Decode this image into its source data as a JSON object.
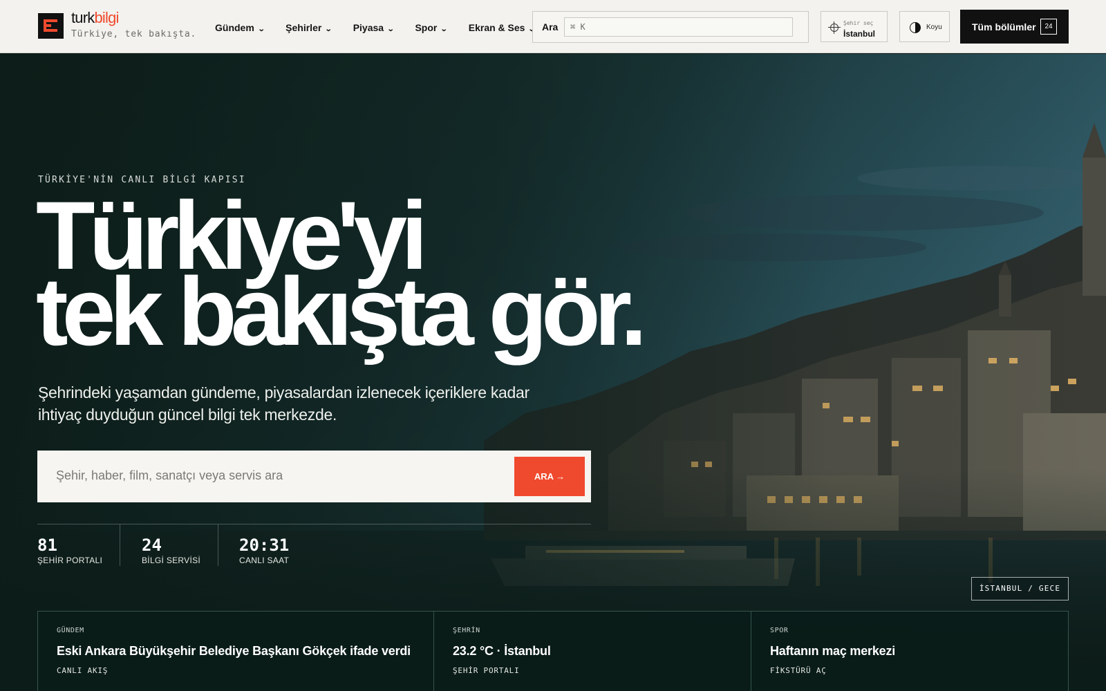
{
  "brand": {
    "name_part1": "turk",
    "name_part2": "bilgi",
    "tagline": "Türkiye, tek bakışta.",
    "accent_color": "#f04a2e"
  },
  "nav": {
    "items": [
      {
        "label": "Gündem"
      },
      {
        "label": "Şehirler"
      },
      {
        "label": "Piyasa"
      },
      {
        "label": "Spor"
      },
      {
        "label": "Ekran & Ses"
      }
    ],
    "chevron_icon": "chevron-down-icon"
  },
  "header_search": {
    "label": "Ara",
    "shortcut": "⌘ K"
  },
  "city_selector": {
    "caption": "Şehir seç",
    "value": "İstanbul",
    "icon": "crosshair-icon"
  },
  "theme_toggle": {
    "label": "Koyu",
    "icon": "half-moon-icon"
  },
  "all_sections": {
    "label": "Tüm bölümler",
    "count": "24"
  },
  "hero": {
    "eyebrow": "TÜRKİYE'NİN CANLI BİLGİ KAPISI",
    "headline_line1": "Türkiye'yi",
    "headline_line2": "tek bakışta gör.",
    "subtitle": "Şehrindeki yaşamdan gündeme, piyasalardan izlenecek içeriklere kadar ihtiyaç duyduğun güncel bilgi tek merkezde.",
    "search_placeholder": "Şehir, haber, film, sanatçı veya servis ara",
    "search_button": "ARA →",
    "image_caption": "İSTANBUL / GECE"
  },
  "stats": [
    {
      "value": "81",
      "label": "ŞEHİR PORTALI"
    },
    {
      "value": "24",
      "label": "BİLGİ SERVİSİ"
    },
    {
      "value": "20:31",
      "label": "CANLI SAAT"
    }
  ],
  "cards": [
    {
      "category": "GÜNDEM",
      "title": "Eski Ankara Büyükşehir Belediye Başkanı Gökçek ifade verdi",
      "action": "CANLI AKIŞ"
    },
    {
      "category": "ŞEHRİN",
      "title": "23.2 °C · İstanbul",
      "action": "ŞEHİR PORTALI"
    },
    {
      "category": "SPOR",
      "title": "Haftanın maç merkezi",
      "action": "FİKSTÜRÜ AÇ"
    }
  ]
}
